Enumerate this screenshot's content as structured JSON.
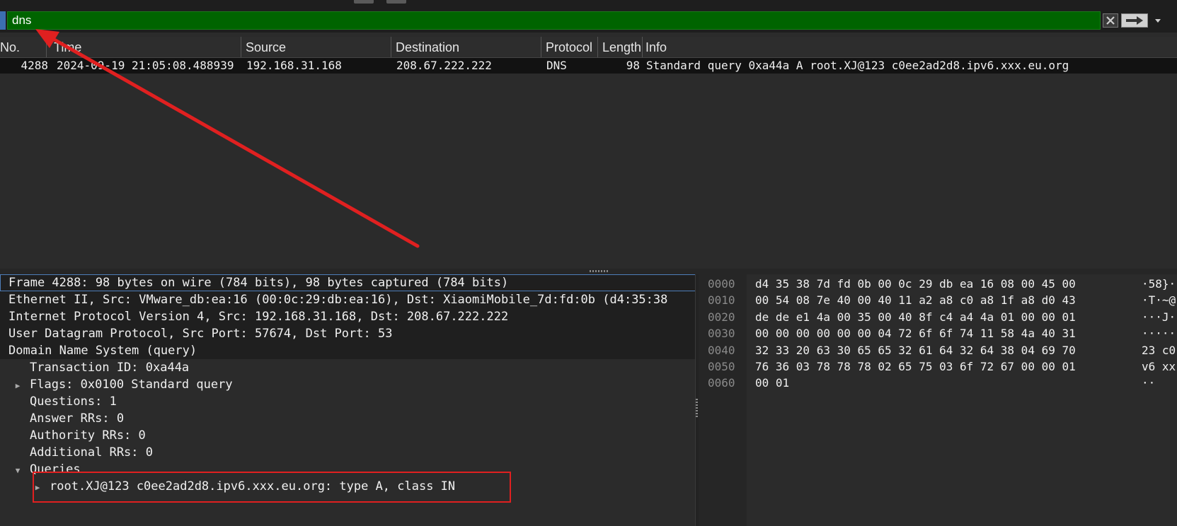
{
  "filter": {
    "value": "dns"
  },
  "columns": [
    "No.",
    "Time",
    "Source",
    "Destination",
    "Protocol",
    "Length",
    "Info"
  ],
  "packets": [
    {
      "no": "4288",
      "time": "2024-09-19 21:05:08.488939",
      "source": "192.168.31.168",
      "destination": "208.67.222.222",
      "protocol": "DNS",
      "length": "98",
      "info": "Standard query 0xa44a A root.XJ@123 c0ee2ad2d8.ipv6.xxx.eu.org"
    }
  ],
  "details": {
    "frame": "Frame 4288: 98 bytes on wire (784 bits), 98 bytes captured (784 bits)",
    "ethernet": "Ethernet II, Src: VMware_db:ea:16 (00:0c:29:db:ea:16), Dst: XiaomiMobile_7d:fd:0b (d4:35:38",
    "ip": "Internet Protocol Version 4, Src: 192.168.31.168, Dst: 208.67.222.222",
    "udp": "User Datagram Protocol, Src Port: 57674, Dst Port: 53",
    "dns": "Domain Name System (query)",
    "transaction_id": "Transaction ID: 0xa44a",
    "flags": "Flags: 0x0100 Standard query",
    "questions": "Questions: 1",
    "answer_rrs": "Answer RRs: 0",
    "authority_rrs": "Authority RRs: 0",
    "additional_rrs": "Additional RRs: 0",
    "queries": "Queries",
    "query_entry": "root.XJ@123 c0ee2ad2d8.ipv6.xxx.eu.org: type A, class IN"
  },
  "hex": {
    "rows": [
      {
        "offset": "0000",
        "bytes": "d4 35 38 7d fd 0b 00 0c  29 db ea 16 08 00 45 00",
        "ascii": "·58}··"
      },
      {
        "offset": "0010",
        "bytes": "00 54 08 7e 40 00 40 11  a2 a8 c0 a8 1f a8 d0 43",
        "ascii": "·T·~@"
      },
      {
        "offset": "0020",
        "bytes": "de de e1 4a 00 35 00 40  8f c4 a4 4a 01 00 00 01",
        "ascii": "···J·"
      },
      {
        "offset": "0030",
        "bytes": "00 00 00 00 00 00 04 72  6f 6f 74 11 58 4a 40 31",
        "ascii": "······"
      },
      {
        "offset": "0040",
        "bytes": "32 33 20 63 30 65 65 32  61 64 32 64 38 04 69 70",
        "ascii": "23 c0"
      },
      {
        "offset": "0050",
        "bytes": "76 36 03 78 78 78 02 65  75 03 6f 72 67 00 00 01",
        "ascii": "v6 xx"
      },
      {
        "offset": "0060",
        "bytes": "00 01",
        "ascii": "··"
      }
    ]
  },
  "icons": [
    "clear-filter-icon",
    "apply-filter-arrow-icon",
    "dropdown-icon",
    "expander-icon"
  ],
  "colors": {
    "filter_valid_bg": "#006400",
    "selection_outline": "#4e7db8",
    "annotation_red": "#e02020"
  }
}
